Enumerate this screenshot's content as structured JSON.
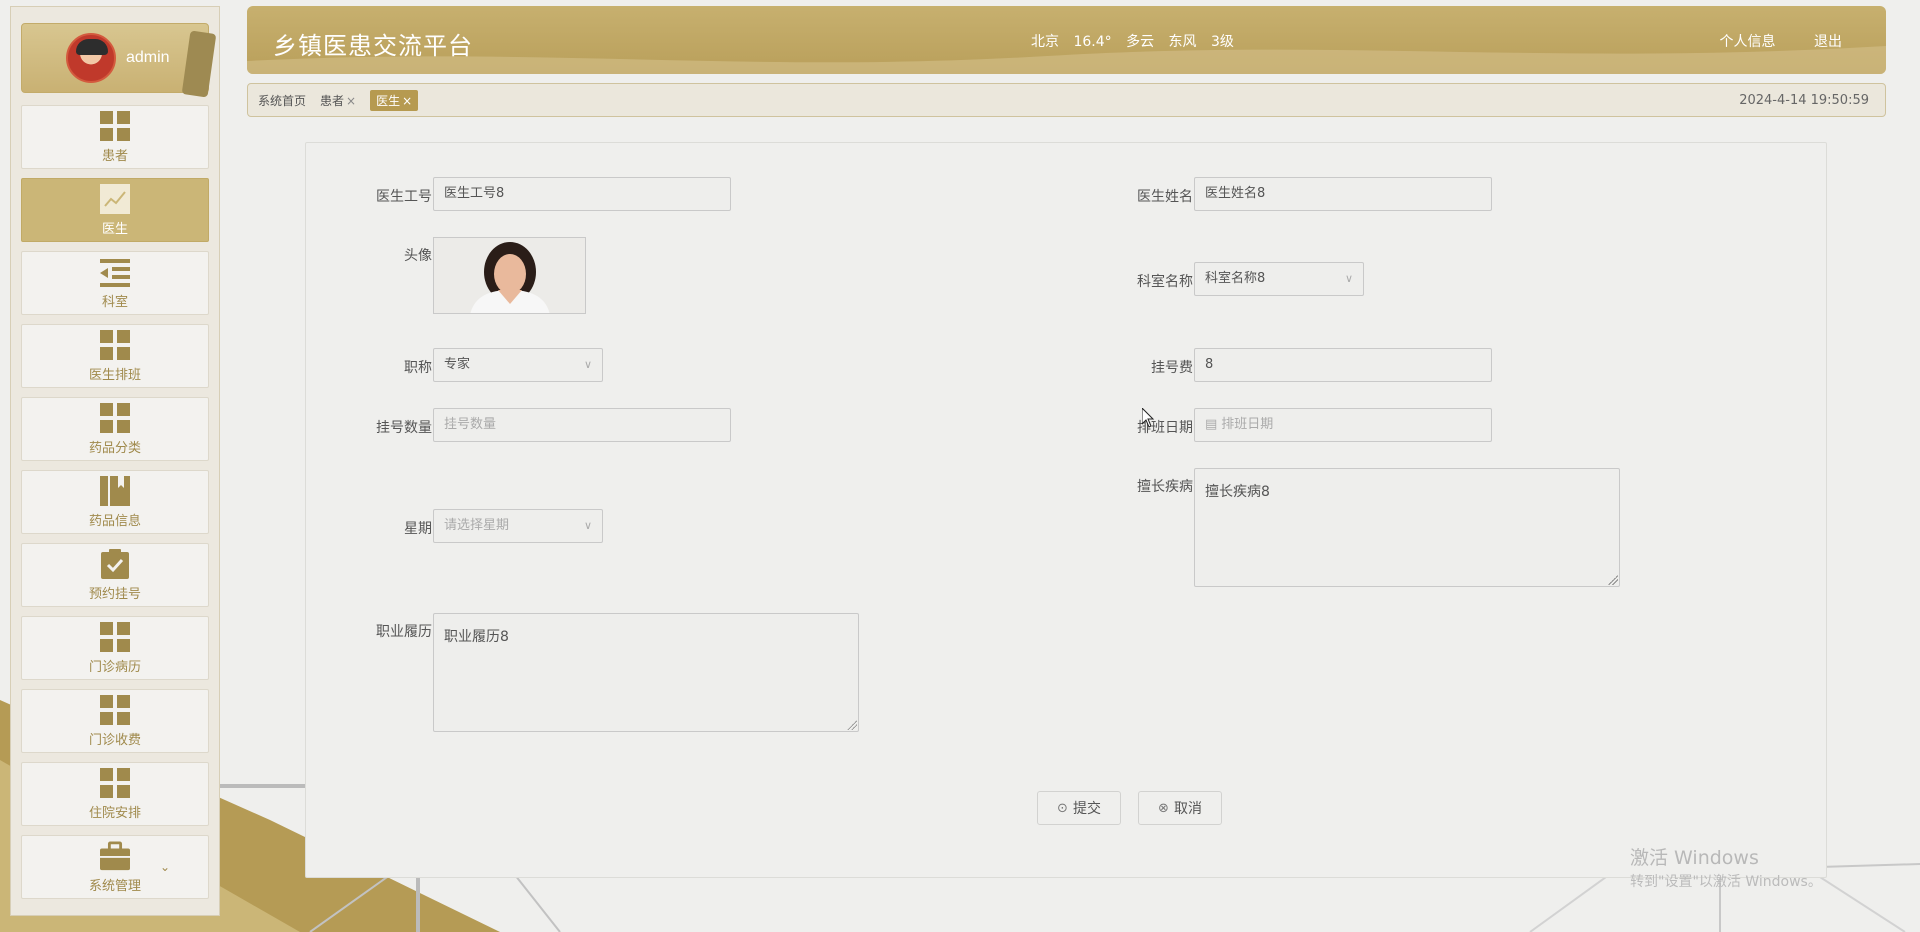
{
  "user": {
    "name": "admin"
  },
  "sidebar": {
    "items": [
      {
        "label": "患者",
        "icon": "grid-icon",
        "active": false
      },
      {
        "label": "医生",
        "icon": "chart-line-icon",
        "active": true
      },
      {
        "label": "科室",
        "icon": "list-indent-icon",
        "active": false
      },
      {
        "label": "医生排班",
        "icon": "grid-icon",
        "active": false
      },
      {
        "label": "药品分类",
        "icon": "grid-icon",
        "active": false
      },
      {
        "label": "药品信息",
        "icon": "book-icon",
        "active": false
      },
      {
        "label": "预约挂号",
        "icon": "clipboard-check-icon",
        "active": false
      },
      {
        "label": "门诊病历",
        "icon": "grid-icon",
        "active": false
      },
      {
        "label": "门诊收费",
        "icon": "grid-icon",
        "active": false
      },
      {
        "label": "住院安排",
        "icon": "grid-icon",
        "active": false
      },
      {
        "label": "系统管理",
        "icon": "briefcase-icon",
        "active": false
      }
    ]
  },
  "header": {
    "title": "乡镇医患交流平台",
    "weather": {
      "city": "北京",
      "temp": "16.4°",
      "condition": "多云",
      "wind": "东风",
      "level": "3级"
    },
    "profile_link": "个人信息",
    "logout_link": "退出"
  },
  "tabs": [
    {
      "label": "系统首页",
      "closable": false
    },
    {
      "label": "患者",
      "closable": true
    },
    {
      "label": "医生",
      "closable": true,
      "active": true
    }
  ],
  "tab_close": "×",
  "datetime": "2024-4-14 19:50:59",
  "form": {
    "doctor_id": {
      "label": "医生工号",
      "value": "医生工号8"
    },
    "doctor_name": {
      "label": "医生姓名",
      "value": "医生姓名8"
    },
    "avatar": {
      "label": "头像"
    },
    "department": {
      "label": "科室名称",
      "value": "科室名称8"
    },
    "title": {
      "label": "职称",
      "value": "专家"
    },
    "fee": {
      "label": "挂号费",
      "value": "8"
    },
    "quota": {
      "label": "挂号数量",
      "placeholder": "挂号数量"
    },
    "schedule_date": {
      "label": "排班日期",
      "placeholder": "排班日期"
    },
    "specialty": {
      "label": "擅长疾病",
      "value": "擅长疾病8"
    },
    "weekday": {
      "label": "星期",
      "placeholder": "请选择星期"
    },
    "resume": {
      "label": "职业履历",
      "value": "职业履历8"
    }
  },
  "buttons": {
    "submit": "提交",
    "cancel": "取消"
  },
  "watermark": {
    "line1": "激活 Windows",
    "line2": "转到\"设置\"以激活 Windows。"
  },
  "colors": {
    "accent": "#b99f5a",
    "active_menu": "#cbb677",
    "menu_text": "#a08a4c"
  }
}
